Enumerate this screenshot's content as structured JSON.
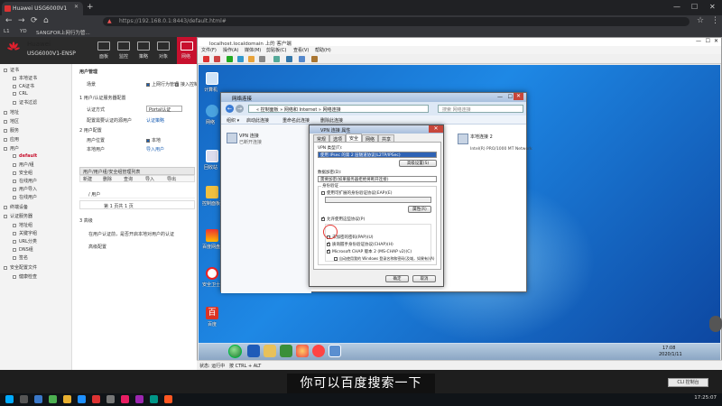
{
  "browser": {
    "tab_title": "Huawei USG6000V1",
    "url": "https://192.168.0.1:8443/default.html#",
    "bookmarks": [
      "L1",
      "YD",
      "SANGFOR上网行为管..."
    ]
  },
  "huawei": {
    "brand": "Huawei",
    "model": "USG6000V1-ENSP",
    "top_nav": [
      "面板",
      "监控",
      "策略",
      "对象",
      "网络",
      "系统"
    ],
    "sidebar": [
      {
        "label": "证书",
        "active": false
      },
      {
        "label": "本地证书",
        "active": false
      },
      {
        "label": "CA证书",
        "active": false
      },
      {
        "label": "CRL",
        "active": false
      },
      {
        "label": "证书过滤",
        "active": false
      },
      {
        "label": "地址",
        "active": false
      },
      {
        "label": "地区",
        "active": false
      },
      {
        "label": "服务",
        "active": false
      },
      {
        "label": "应用",
        "active": false
      },
      {
        "label": "用户",
        "active": false
      },
      {
        "label": "default",
        "active": true
      },
      {
        "label": "用户/组",
        "active": false
      },
      {
        "label": "安全组",
        "active": false
      },
      {
        "label": "在线用户",
        "active": false
      },
      {
        "label": "用户导入",
        "active": false
      },
      {
        "label": "在线用户",
        "active": false
      },
      {
        "label": "终端设备",
        "active": false
      },
      {
        "label": "认证服务器",
        "active": false
      },
      {
        "label": "地址组",
        "active": false
      },
      {
        "label": "关键字组",
        "active": false
      },
      {
        "label": "URL分类",
        "active": false
      },
      {
        "label": "DNS组",
        "active": false
      },
      {
        "label": "签名",
        "active": false
      },
      {
        "label": "安全配置文件",
        "active": false
      },
      {
        "label": "健康检查",
        "active": false
      }
    ],
    "main": {
      "section_title": "用户管理",
      "scene_label": "场景",
      "scene_opt1": "上网行为管理",
      "scene_opt2": "接入控制",
      "sub1": "1 用户/认证服务器配置",
      "auth_label": "认证方式",
      "auth_value": "Portal认证",
      "import_label": "配置需要认证的源用户",
      "import_link": "认证策略",
      "sub2": "2 用户配置",
      "user_sync_label": "用户位置",
      "user_sync_value": "本地",
      "local_user_label": "本地用户",
      "local_user_link": "导入用户",
      "grid_title": "用户/用户组/安全组管理列表",
      "grid_tools": [
        "新建",
        "删除",
        "查询",
        "导入",
        "导出"
      ],
      "grid_row": "/ 用户",
      "pager_text": "第 1 页共 1 页",
      "sub3": "3 高级",
      "adv1": "在用户认证前，是否开启本地对用户的认证",
      "adv2": "高级配置"
    }
  },
  "remote": {
    "title": "localhost.localdomain 上的 客户端",
    "menu": [
      "文件(F)",
      "操作(A)",
      "媒体(M)",
      "剪贴板(C)",
      "查看(V)",
      "帮助(H)"
    ],
    "status": "状态: 运行中",
    "status_hint": "按 CTRL + ALT",
    "desktop_icons": [
      "计算机",
      "网络",
      "回收站",
      "控制面板",
      "百度网盘",
      "安全卫士",
      "百度"
    ],
    "taskbar_time": "17:08",
    "taskbar_date": "2020/1/11"
  },
  "network_window": {
    "title": "网络连接",
    "address": "« 控制面板 » 网络和 Internet » 网络连接",
    "search_placeholder": "搜索 网络连接",
    "commands": [
      "组织 ▾",
      "启动此连接",
      "重命名此连接",
      "删除此连接"
    ],
    "connection_name": "VPN 连接",
    "connection_desc": "已断开连接",
    "right_item_name": "本地连接 2",
    "right_item_desc": "Intel(R) PRO/1000 MT Network"
  },
  "dialog": {
    "title": "VPN 连接 属性",
    "tabs": [
      "常规",
      "选项",
      "安全",
      "网络",
      "共享"
    ],
    "vpn_type_label": "VPN 类型(T):",
    "vpn_type_value": "使用 IPsec 的第 2 层隧道协议(L2TP/IPSec)",
    "advanced_button": "高级设置(S)",
    "encryption_label": "数据加密(D):",
    "encryption_value": "需要加密(如果服务器拒绝将断开连接)",
    "auth_section": "身份验证",
    "eap_option": "使用可扩展的身份验证协议(EAP)(E)",
    "properties_button": "属性(R)",
    "allow_option": "允许使用这些协议(P)",
    "pap_option": "未加密的密码(PAP)(U)",
    "chap_option": "质询握手身份验证协议(CHAP)(H)",
    "mschap_option": "Microsoft CHAP 版本 2 (MS-CHAP v2)(C)",
    "autologon_option": "自动使用我的 Windows 登录名称和密码(及域，如果有)(A)",
    "ok_button": "确定",
    "cancel_button": "取消"
  },
  "subtitle": "你可以百度搜索一下",
  "cli_button": "CLI 控制台",
  "host_clock": "17:25:07"
}
